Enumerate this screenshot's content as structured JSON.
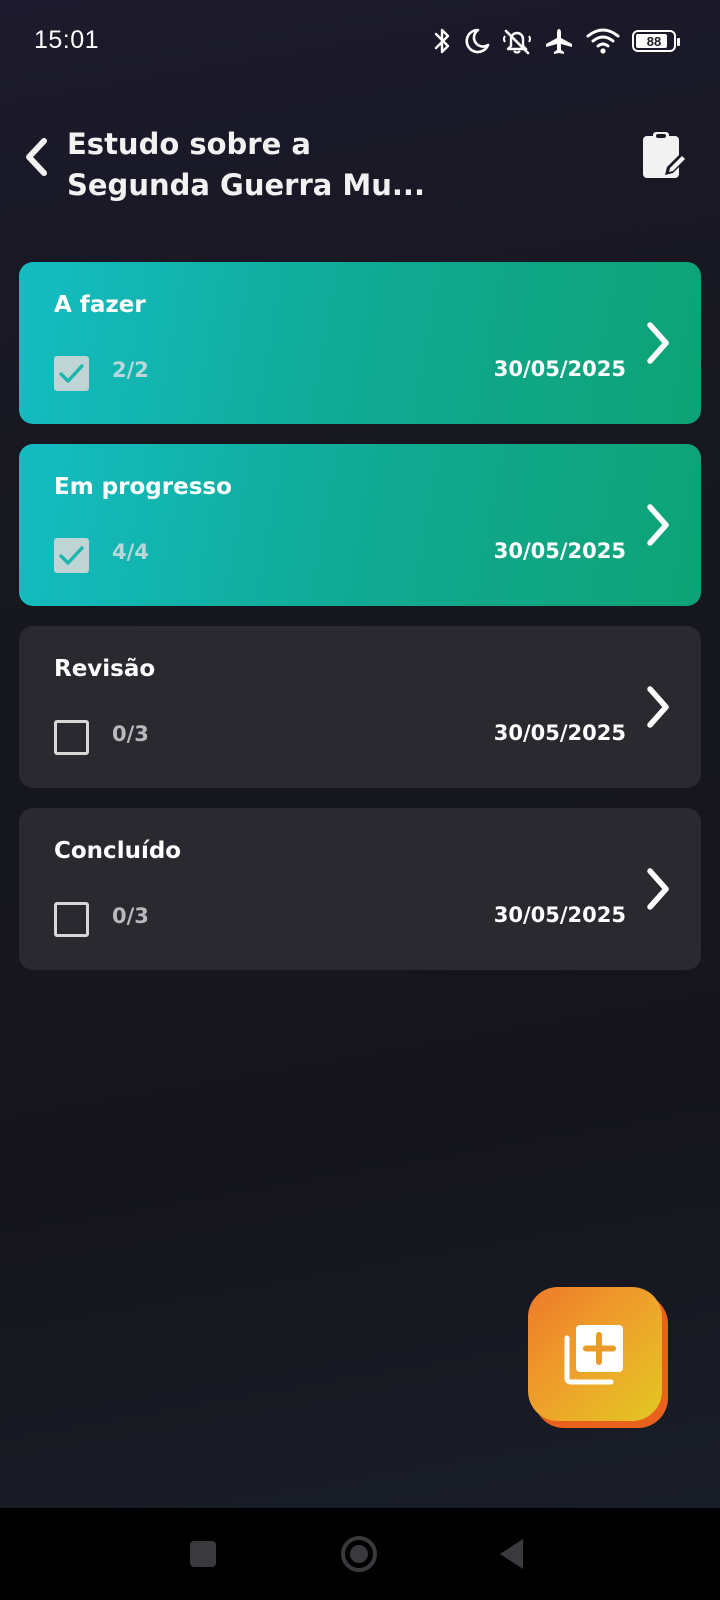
{
  "status_bar": {
    "time": "15:01",
    "battery_level": "88",
    "battery_fraction": 0.88,
    "icons": [
      "bluetooth-icon",
      "moon-icon",
      "bell-off-icon",
      "airplane-icon",
      "wifi-icon",
      "battery-icon"
    ]
  },
  "header": {
    "title_line1": "Estudo sobre a",
    "title_line2": "Segunda Guerra Mu...",
    "back_icon": "chevron-left-icon",
    "edit_icon": "clipboard-edit-icon"
  },
  "cards": [
    {
      "title": "A fazer",
      "count": "2/2",
      "date": "30/05/2025",
      "checked": true,
      "style": "active"
    },
    {
      "title": "Em progresso",
      "count": "4/4",
      "date": "30/05/2025",
      "checked": true,
      "style": "active"
    },
    {
      "title": "Revisão",
      "count": "0/3",
      "date": "30/05/2025",
      "checked": false,
      "style": "idle"
    },
    {
      "title": "Concluído",
      "count": "0/3",
      "date": "30/05/2025",
      "checked": false,
      "style": "idle"
    }
  ],
  "fab": {
    "icon": "add-to-stack-icon"
  },
  "colors": {
    "active_card_start": "#14bcc2",
    "active_card_end": "#0ea375",
    "idle_card": "#29292f",
    "fab_start": "#ee7a2a",
    "fab_end": "#e2c823",
    "background": "#17171f"
  },
  "nav_bar": {
    "icons": [
      "recent-apps-icon",
      "home-icon",
      "back-triangle-icon"
    ]
  }
}
